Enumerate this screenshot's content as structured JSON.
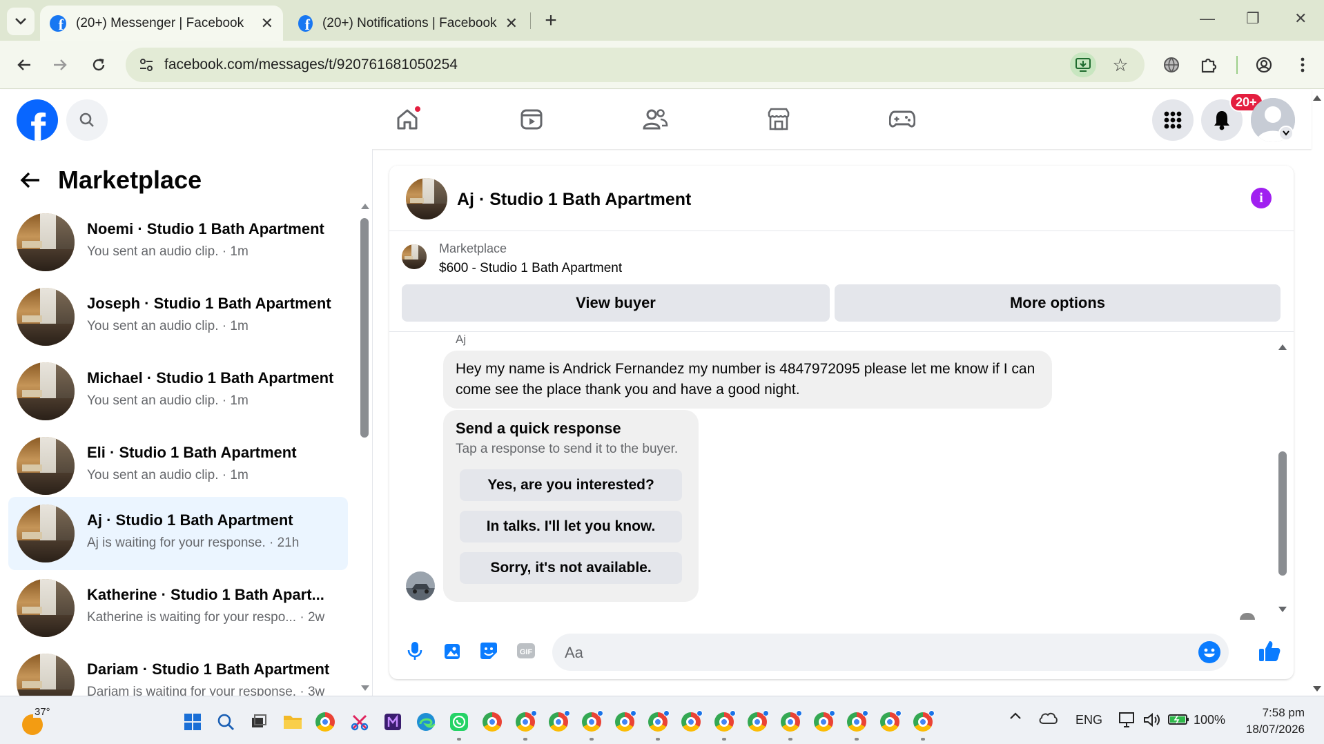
{
  "browser": {
    "tabs": [
      {
        "title": "(20+) Messenger | Facebook",
        "active": true
      },
      {
        "title": "(20+) Notifications | Facebook",
        "active": false
      }
    ],
    "close_glyph": "✕",
    "new_tab_glyph": "+",
    "url": "facebook.com/messages/t/920761681050254",
    "window_controls": {
      "minimize": "—",
      "restore": "❐",
      "close": "✕"
    }
  },
  "facebook": {
    "logo_letter": "f",
    "notifications_badge": "20+",
    "accent_color": "#0866ff",
    "badge_color": "#e41e3f"
  },
  "sidebar": {
    "title": "Marketplace",
    "conversations": [
      {
        "title": "Noemi · Studio 1 Bath Apartment",
        "preview": "You sent an audio clip. · 1m",
        "active": false
      },
      {
        "title": "Joseph · Studio 1 Bath Apartment",
        "preview": "You sent an audio clip. · 1m",
        "active": false
      },
      {
        "title": "Michael · Studio 1 Bath Apartment",
        "preview": "You sent an audio clip. · 1m",
        "active": false
      },
      {
        "title": "Eli · Studio 1 Bath Apartment",
        "preview": "You sent an audio clip. · 1m",
        "active": false
      },
      {
        "title": "Aj · Studio 1 Bath Apartment",
        "preview": "Aj is waiting for your response. · 21h",
        "active": true
      },
      {
        "title": "Katherine · Studio 1 Bath Apart...",
        "preview": "Katherine is waiting for your respo... · 2w",
        "active": false
      },
      {
        "title": "Dariam · Studio 1 Bath Apartment",
        "preview": "Dariam is waiting for your response. · 3w",
        "active": false
      }
    ]
  },
  "chat": {
    "title": "Aj · Studio 1 Bath Apartment",
    "info_glyph": "i",
    "listing": {
      "category": "Marketplace",
      "price_title": "$600 - Studio 1 Bath Apartment",
      "view_buyer_label": "View buyer",
      "more_options_label": "More options"
    },
    "sender_name": "Aj",
    "message": "Hey my name is Andrick Fernandez my number is 4847972095 please let me know if I can come see the place  thank you and have a good night.",
    "quick_response": {
      "title": "Send a quick response",
      "subtitle": "Tap a response to send it to the buyer.",
      "options": [
        "Yes, are you interested?",
        "In talks. I'll let you know.",
        "Sorry, it's not available."
      ]
    },
    "composer_placeholder": "Aa"
  },
  "taskbar": {
    "weather_temp": "37°",
    "language": "ENG",
    "battery": "100%",
    "time": "7:58 pm",
    "date": "18/07/2026"
  }
}
